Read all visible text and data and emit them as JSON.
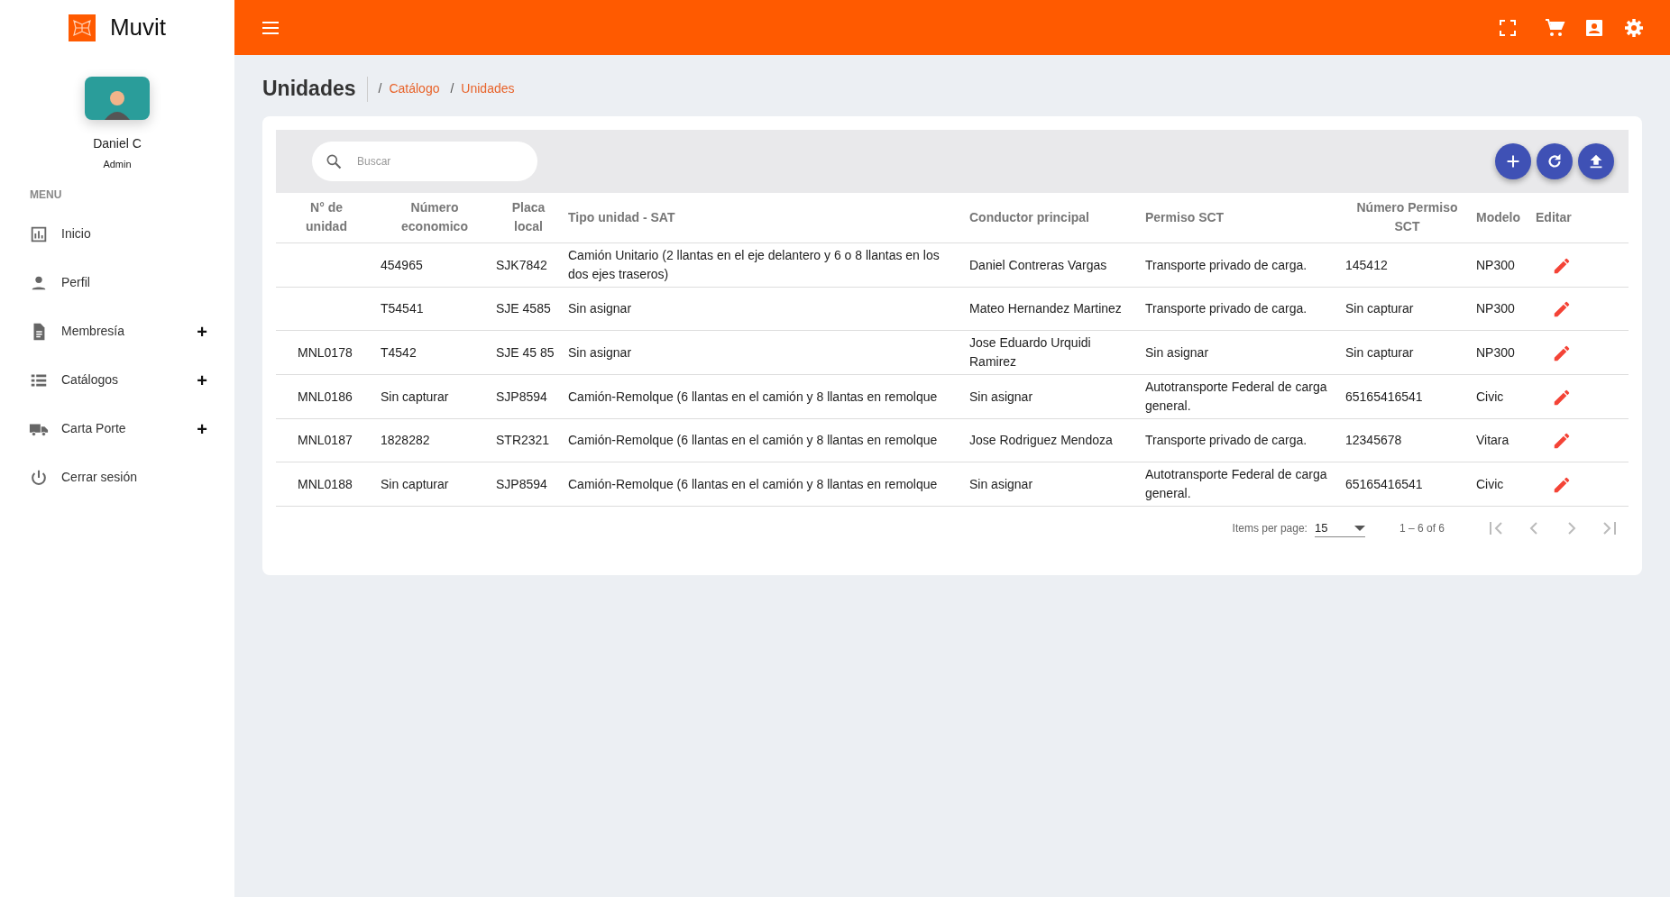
{
  "brand": {
    "name": "Muvit"
  },
  "user": {
    "name": "Daniel C",
    "role": "Admin"
  },
  "menu": {
    "heading": "MENU",
    "items": [
      {
        "label": "Inicio"
      },
      {
        "label": "Perfil"
      },
      {
        "label": "Membresía",
        "toggle": "+"
      },
      {
        "label": "Catálogos",
        "toggle": "+"
      },
      {
        "label": "Carta Porte",
        "toggle": "+"
      },
      {
        "label": "Cerrar sesión"
      }
    ]
  },
  "page": {
    "title": "Unidades",
    "breadcrumb": [
      {
        "separator": "/",
        "label": "Catálogo"
      },
      {
        "separator": "/",
        "label": "Unidades"
      }
    ]
  },
  "search": {
    "placeholder": "Buscar"
  },
  "table": {
    "columns": [
      "N° de unidad",
      "Número economico",
      "Placa local",
      "Tipo unidad - SAT",
      "Conductor principal",
      "Permiso SCT",
      "Número Permiso SCT",
      "Modelo",
      "Editar"
    ],
    "rows": [
      {
        "unit_number": null,
        "economic_number": "454965",
        "local_plate": "SJK7842",
        "unit_type_sat": "Camión Unitario (2 llantas en el eje delantero y 6 o 8 llantas en los dos ejes traseros)",
        "main_driver": "Daniel Contreras Vargas",
        "sct_permit": "Transporte privado de carga.",
        "sct_permit_number": "145412",
        "model": "NP300"
      },
      {
        "unit_number": null,
        "economic_number": "T54541",
        "local_plate": "SJE 4585",
        "unit_type_sat": "Sin asignar",
        "main_driver": "Mateo Hernandez Martinez",
        "sct_permit": "Transporte privado de carga.",
        "sct_permit_number": "Sin capturar",
        "model": "NP300"
      },
      {
        "unit_number": "MNL0178",
        "economic_number": "T4542",
        "local_plate": "SJE 45 85",
        "unit_type_sat": "Sin asignar",
        "main_driver": "Jose Eduardo Urquidi Ramirez",
        "sct_permit": "Sin asignar",
        "sct_permit_number": "Sin capturar",
        "model": "NP300"
      },
      {
        "unit_number": "MNL0186",
        "economic_number": "Sin capturar",
        "local_plate": "SJP8594",
        "unit_type_sat": "Camión-Remolque (6 llantas en el camión y 8 llantas en remolque",
        "main_driver": "Sin asignar",
        "sct_permit": "Autotransporte Federal de carga general.",
        "sct_permit_number": "65165416541",
        "model": "Civic"
      },
      {
        "unit_number": "MNL0187",
        "economic_number": "1828282",
        "local_plate": "STR2321",
        "unit_type_sat": "Camión-Remolque (6 llantas en el camión y 8 llantas en remolque",
        "main_driver": "Jose Rodriguez Mendoza",
        "sct_permit": "Transporte privado de carga.",
        "sct_permit_number": "12345678",
        "model": "Vitara"
      },
      {
        "unit_number": "MNL0188",
        "economic_number": "Sin capturar",
        "local_plate": "SJP8594",
        "unit_type_sat": "Camión-Remolque (6 llantas en el camión y 8 llantas en remolque",
        "main_driver": "Sin asignar",
        "sct_permit": "Autotransporte Federal de carga general.",
        "sct_permit_number": "65165416541",
        "model": "Civic"
      }
    ]
  },
  "paginator": {
    "items_per_page_label": "Items per page:",
    "page_size": "15",
    "range": "1 – 6 of 6",
    "buttons": [
      {
        "kind": "first",
        "disabled": true
      },
      {
        "kind": "prev",
        "disabled": true
      },
      {
        "kind": "next",
        "disabled": true
      },
      {
        "kind": "last",
        "disabled": true
      }
    ]
  }
}
